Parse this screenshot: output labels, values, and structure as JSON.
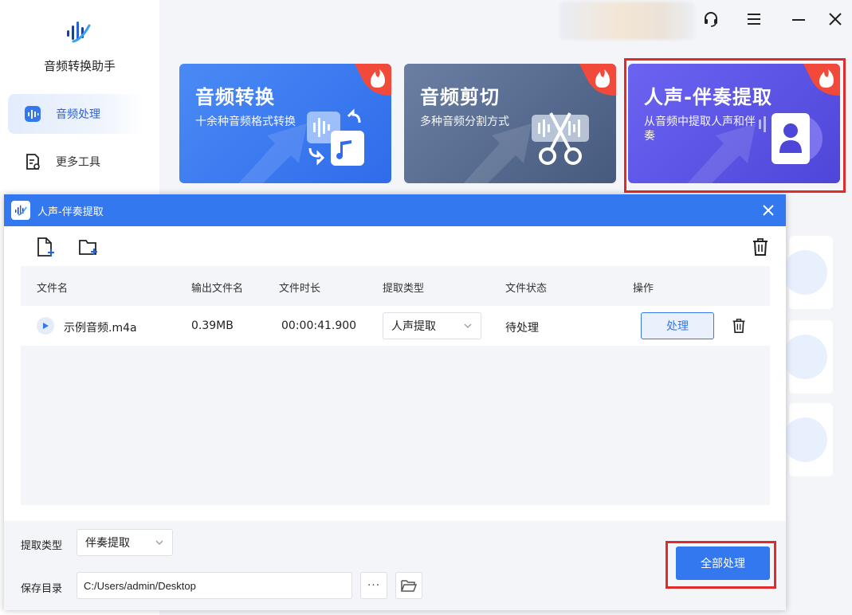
{
  "app": {
    "title": "音频转换助手"
  },
  "sidebar": {
    "items": [
      {
        "label": "音频处理",
        "icon": "audio-wave-icon",
        "active": true
      },
      {
        "label": "更多工具",
        "icon": "document-tool-icon",
        "active": false
      }
    ]
  },
  "topbar": {
    "icons": [
      "headset-support-icon",
      "menu-icon",
      "minimize-icon",
      "close-icon"
    ]
  },
  "cards": [
    {
      "title": "音频转换",
      "desc": "十余种音频格式转换",
      "color": "#3b7cf0",
      "badge": "hot-flame-icon"
    },
    {
      "title": "音频剪切",
      "desc": "多种音频分割方式",
      "color": "#52668a",
      "badge": "hot-flame-icon"
    },
    {
      "title": "人声-伴奏提取",
      "desc": "从音频中提取人声和伴奏",
      "color": "#5b52e6",
      "badge": "hot-flame-icon"
    }
  ],
  "dialog": {
    "title": "人声-伴奏提取",
    "columns": {
      "filename": "文件名",
      "output_name": "输出文件名",
      "duration": "文件时长",
      "extract_type": "提取类型",
      "status": "文件状态",
      "action": "操作"
    },
    "rows": [
      {
        "filename": "示例音频.m4a",
        "output_size": "0.39MB",
        "duration": "00:00:41.900",
        "extract_type": "人声提取",
        "status": "待处理",
        "action_label": "处理"
      }
    ],
    "footer": {
      "type_label": "提取类型",
      "type_value": "伴奏提取",
      "dir_label": "保存目录",
      "dir_value": "C:/Users/admin/Desktop",
      "more_label": "···",
      "process_all_label": "全部处理"
    }
  },
  "colors": {
    "accent": "#3378ee",
    "highlight": "#e02b2b",
    "panel_bg": "#f3f5f9"
  }
}
